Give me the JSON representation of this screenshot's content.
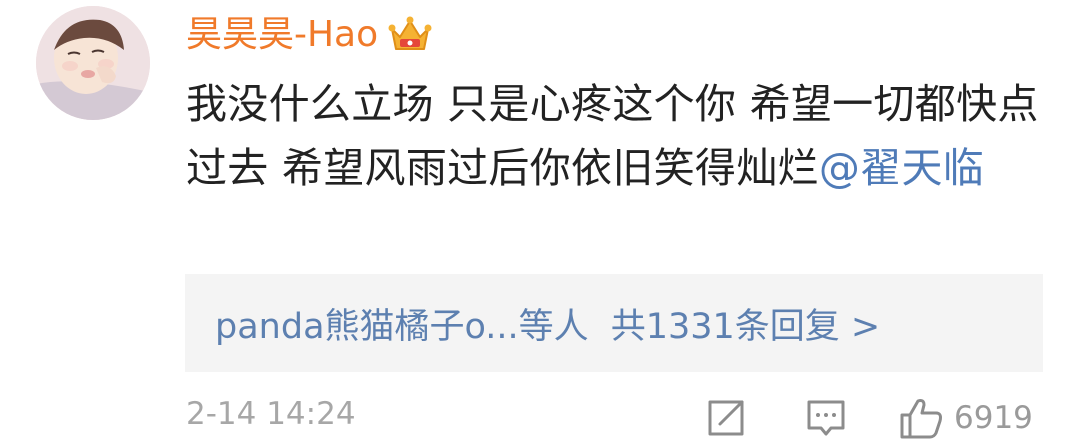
{
  "comment": {
    "username": "昊昊昊-Hao",
    "badge_icon": "crown-icon",
    "text": "我没什么立场 只是心疼这个你 希望一切都快点过去 希望风雨过后你依旧笑得灿烂",
    "mention": "@翟天临",
    "replies": {
      "summary": "panda熊猫橘子o...等人",
      "count": "共1331条回复 >"
    },
    "timestamp": "2-14 14:24",
    "actions": {
      "share_icon": "share-icon",
      "reply_icon": "reply-icon",
      "like_icon": "thumbs-up-icon",
      "like_count": "6919"
    }
  },
  "colors": {
    "username": "#f07a2a",
    "link": "#5d80b0",
    "text": "#222222",
    "meta": "#a7a7a7",
    "reply_bg": "#f4f4f4"
  }
}
